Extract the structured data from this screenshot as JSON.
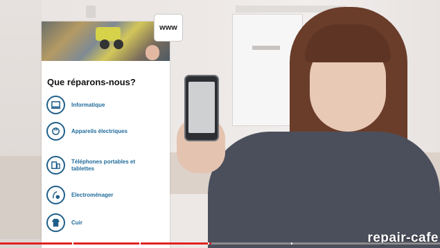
{
  "overlay": {
    "www_label": "www",
    "heading": "Que réparons-nous?",
    "items": [
      {
        "label": "Informatique",
        "icon": "laptop-icon"
      },
      {
        "label": "Appareils électriques",
        "icon": "plug-icon"
      },
      {
        "label": "Téléphones portables et tablettes",
        "icon": "devices-icon"
      },
      {
        "label": "Electroménager",
        "icon": "vacuum-icon"
      },
      {
        "label": "Cuir",
        "icon": "jacket-icon"
      }
    ]
  },
  "player": {
    "progress": 0.48,
    "watermark": "repair-cafe"
  },
  "colors": {
    "accent": "#1f6b9a",
    "progress": "#e02020"
  }
}
